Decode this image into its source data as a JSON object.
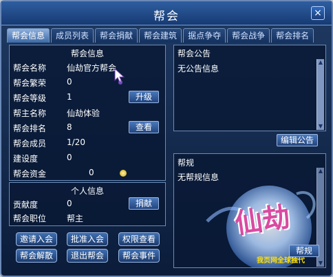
{
  "window": {
    "title": "帮会",
    "close_icon": "close-icon"
  },
  "tabs": [
    {
      "label": "帮会信息"
    },
    {
      "label": "成员列表"
    },
    {
      "label": "帮会捐献"
    },
    {
      "label": "帮会建筑"
    },
    {
      "label": "据点争夺"
    },
    {
      "label": "帮会战争"
    },
    {
      "label": "帮会排名"
    }
  ],
  "guild_info": {
    "section_title": "帮会信息",
    "rows": [
      {
        "label": "帮会名称",
        "value": "仙劫官方帮会"
      },
      {
        "label": "帮会繁荣",
        "value": "0"
      },
      {
        "label": "帮会等级",
        "value": "1",
        "button": "升级"
      },
      {
        "label": "帮主名称",
        "value": "仙劫体验"
      },
      {
        "label": "帮会排名",
        "value": "8",
        "button": "查看"
      },
      {
        "label": "帮会成员",
        "value": "1/20"
      },
      {
        "label": "建设度",
        "value": "0"
      },
      {
        "label": "帮会资金",
        "value": "0"
      }
    ]
  },
  "personal_info": {
    "section_title": "个人信息",
    "rows": [
      {
        "label": "贡献度",
        "value": "0",
        "button": "捐献"
      },
      {
        "label": "帮会职位",
        "value": "帮主"
      }
    ]
  },
  "announcement": {
    "title": "帮会公告",
    "text": "无公告信息",
    "edit_button": "编辑公告"
  },
  "rules": {
    "title": "帮规",
    "text": "无帮规信息",
    "button": "帮规"
  },
  "actions": [
    {
      "label": "邀请入会"
    },
    {
      "label": "批准入会"
    },
    {
      "label": "权限查看"
    },
    {
      "label": "帮会解散"
    },
    {
      "label": "退出帮会"
    },
    {
      "label": "帮会事件"
    }
  ],
  "logo": {
    "text": "仙劫",
    "subtitle": "我页网全球独代"
  }
}
